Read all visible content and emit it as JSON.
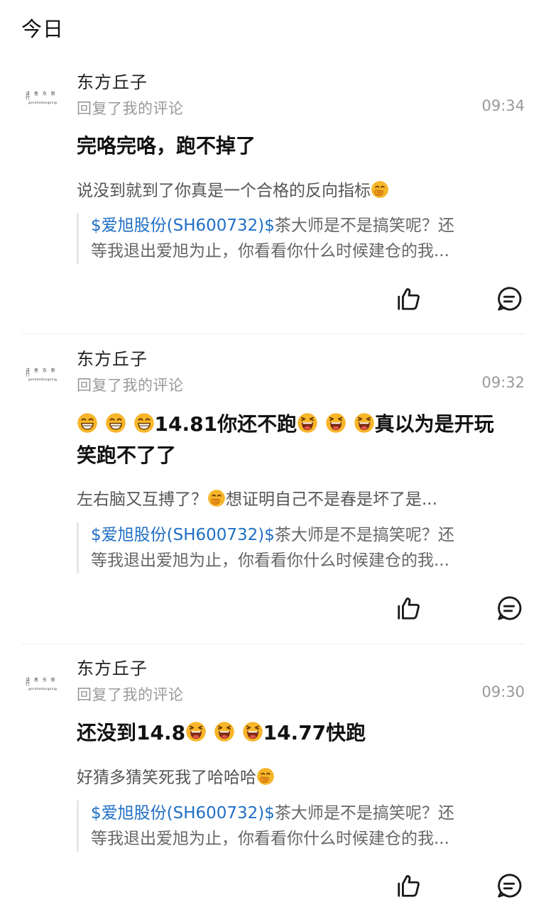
{
  "header": {
    "title": "今日"
  },
  "items": [
    {
      "name": "东方丘子",
      "avatar": {
        "line1": "讲 者 东 新 行",
        "line2": "genzhedongxing"
      },
      "action": "回复了我的评论",
      "time": "09:34",
      "title": {
        "text1": "完咯完咯，跑不掉了"
      },
      "body": {
        "text1": "说没到就到了你真是一个合格的反向指标"
      },
      "quote": {
        "stock": "$爱旭股份(SH600732)$",
        "line1_rest": "茶大师是不是搞笑呢？还",
        "line2": "等我退出爱旭为止，你看看你什么时候建仓的我..."
      }
    },
    {
      "name": "东方丘子",
      "avatar": {
        "line1": "讲 者 东 新 行",
        "line2": "genzhedongxing"
      },
      "action": "回复了我的评论",
      "time": "09:32",
      "title": {
        "text1": "14.81你还不跑",
        "text2": "真以为是开玩",
        "line2": "笑跑不了了"
      },
      "body": {
        "text1": "左右脑又互搏了？",
        "text2": "想证明自己不是春是坏了是..."
      },
      "quote": {
        "stock": "$爱旭股份(SH600732)$",
        "line1_rest": "茶大师是不是搞笑呢？还",
        "line2": "等我退出爱旭为止，你看看你什么时候建仓的我..."
      }
    },
    {
      "name": "东方丘子",
      "avatar": {
        "line1": "讲 者 东 新 行",
        "line2": "genzhedongxing"
      },
      "action": "回复了我的评论",
      "time": "09:30",
      "title": {
        "text1": "还没到14.8",
        "text2": "14.77快跑"
      },
      "body": {
        "text1": "好猜多猜笑死我了哈哈哈"
      },
      "quote": {
        "stock": "$爱旭股份(SH600732)$",
        "line1_rest": "茶大师是不是搞笑呢？还",
        "line2": "等我退出爱旭为止，你看看你什么时候建仓的我..."
      }
    }
  ],
  "icons": {
    "like": "thumbs-up-icon",
    "comment": "comment-bubble-icon",
    "emoji_grin": "grinning-emoji-icon",
    "emoji_laugh": "laughing-emoji-icon",
    "emoji_hush": "face-with-hand-over-mouth-emoji-icon"
  },
  "colors": {
    "stock_link": "#1f6fc5",
    "muted": "#999999",
    "emoji": "#f5b321"
  }
}
